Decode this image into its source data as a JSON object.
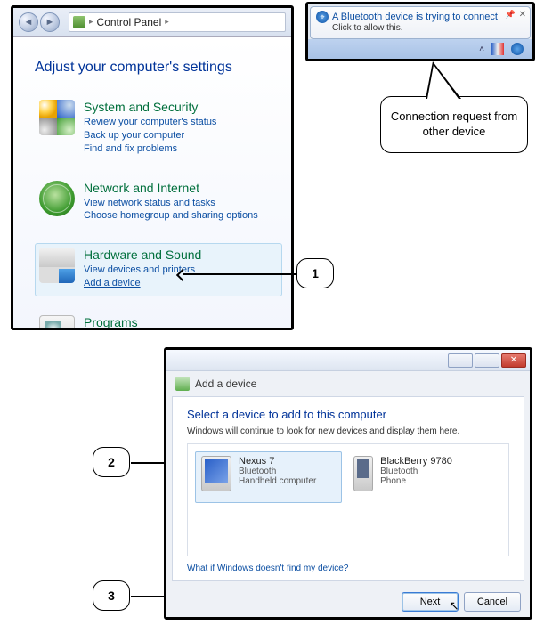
{
  "control_panel": {
    "breadcrumb_label": "Control Panel",
    "heading": "Adjust your computer's settings",
    "categories": [
      {
        "title": "System and Security",
        "links": [
          "Review your computer's status",
          "Back up your computer",
          "Find and fix problems"
        ],
        "selected": false
      },
      {
        "title": "Network and Internet",
        "links": [
          "View network status and tasks",
          "Choose homegroup and sharing options"
        ],
        "selected": false
      },
      {
        "title": "Hardware and Sound",
        "links": [
          "View devices and printers",
          "Add a device"
        ],
        "selected": true,
        "underline_last": true
      },
      {
        "title": "Programs",
        "links": [],
        "selected": false
      }
    ]
  },
  "notification": {
    "title": "A Bluetooth device is trying to connect",
    "subtitle": "Click to allow this."
  },
  "annotation": {
    "text": "Connection request from other device"
  },
  "callouts": {
    "one": "1",
    "two": "2",
    "three": "3"
  },
  "dialog": {
    "crumb": "Add a device",
    "heading": "Select a device to add to this computer",
    "subtext": "Windows will continue to look for new devices and display them here.",
    "devices": [
      {
        "name": "Nexus 7",
        "type": "Bluetooth",
        "sub": "Handheld computer",
        "selected": true,
        "icon": "tab"
      },
      {
        "name": "BlackBerry 9780",
        "type": "Bluetooth",
        "sub": "Phone",
        "selected": false,
        "icon": "phone"
      }
    ],
    "help_link": "What if Windows doesn't find my device?",
    "next": "Next",
    "cancel": "Cancel"
  }
}
